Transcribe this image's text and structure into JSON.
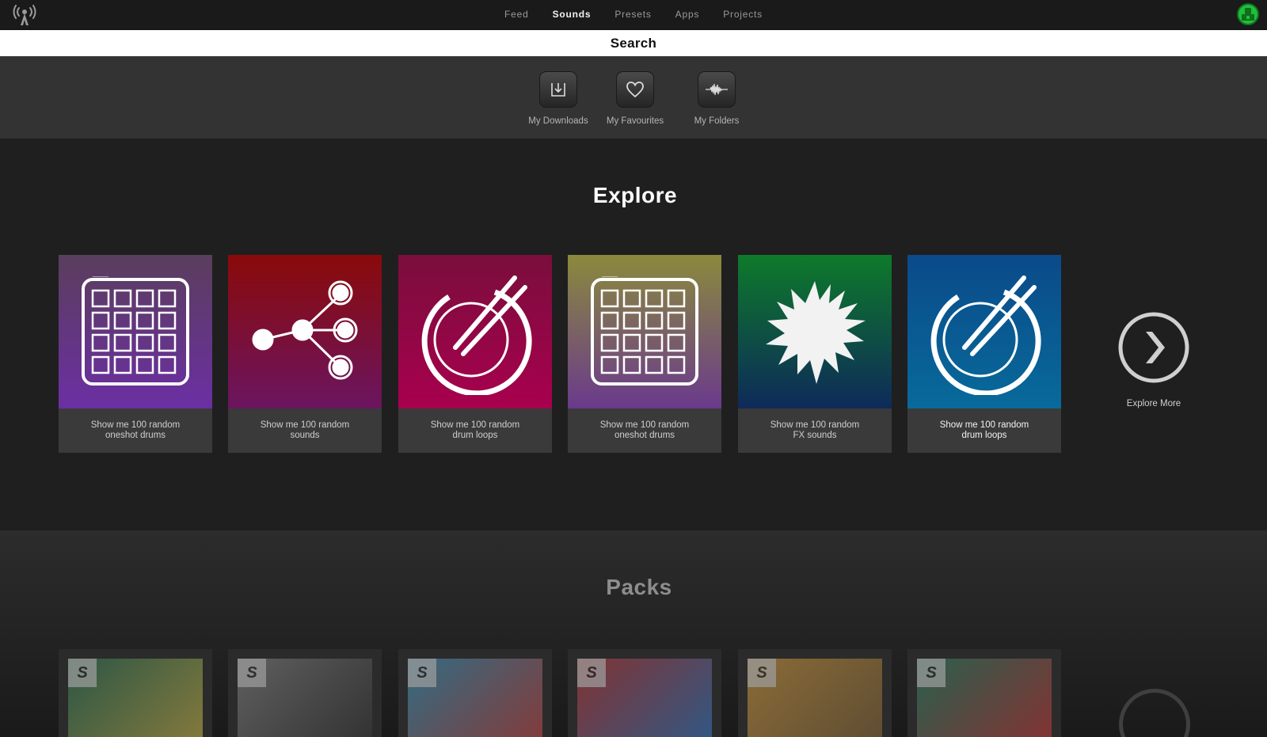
{
  "nav": {
    "items": [
      {
        "label": "Feed",
        "active": false
      },
      {
        "label": "Sounds",
        "active": true
      },
      {
        "label": "Presets",
        "active": false
      },
      {
        "label": "Apps",
        "active": false
      },
      {
        "label": "Projects",
        "active": false
      }
    ]
  },
  "search": {
    "label": "Search"
  },
  "quick_links": [
    {
      "label": "My Downloads",
      "icon": "download-icon"
    },
    {
      "label": "My Favourites",
      "icon": "heart-icon"
    },
    {
      "label": "My Folders",
      "icon": "waveform-icon"
    }
  ],
  "explore": {
    "title": "Explore",
    "cards": [
      {
        "line1": "Show me 100 random",
        "line2": "oneshot drums",
        "icon": "drum-pad-icon",
        "colors": [
          "#5a3e5c",
          "#6b2fa3"
        ]
      },
      {
        "line1": "Show me 100 random",
        "line2": "sounds",
        "icon": "share-nodes-icon",
        "colors": [
          "#8a0a0a",
          "#6b1560"
        ]
      },
      {
        "line1": "Show me 100 random",
        "line2": "drum loops",
        "icon": "drum-sticks-icon",
        "colors": [
          "#7a0e3c",
          "#a8004e"
        ]
      },
      {
        "line1": "Show me 100 random",
        "line2": "oneshot drums",
        "icon": "drum-pad-icon",
        "colors": [
          "#8a8a3c",
          "#6a3a8c"
        ]
      },
      {
        "line1": "Show me 100 random",
        "line2": "FX sounds",
        "icon": "splash-icon",
        "colors": [
          "#0e7a2a",
          "#0e2a5a"
        ]
      },
      {
        "line1": "Show me 100 random",
        "line2": "drum loops",
        "icon": "drum-sticks-icon",
        "colors": [
          "#0a4a8a",
          "#086a9a"
        ]
      }
    ],
    "more_label": "Explore More"
  },
  "packs": {
    "title": "Packs",
    "items": [
      {
        "badge": "S",
        "colors": [
          "#2e7a5a",
          "#c9b84a"
        ]
      },
      {
        "badge": "S",
        "colors": [
          "#8a8a8a",
          "#3a3a3a"
        ]
      },
      {
        "badge": "S",
        "colors": [
          "#3aa0c8",
          "#c84a4a"
        ]
      },
      {
        "badge": "S",
        "colors": [
          "#c83a3a",
          "#3a7ac8"
        ]
      },
      {
        "badge": "S",
        "colors": [
          "#d8a040",
          "#8a6a3a"
        ]
      },
      {
        "badge": "S",
        "colors": [
          "#2a8a6a",
          "#c83a3a"
        ]
      }
    ]
  }
}
